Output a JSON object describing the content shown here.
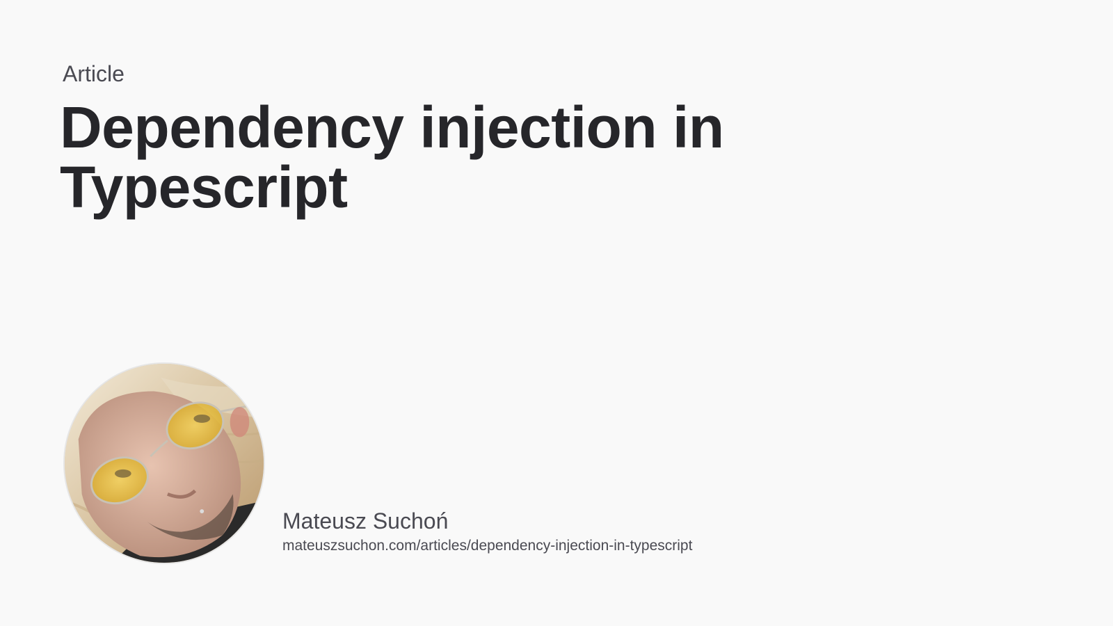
{
  "article": {
    "kind_label": "Article",
    "title": "Dependency injection in Typescript"
  },
  "author": {
    "name": "Mateusz Suchoń",
    "url": "mateuszsuchon.com/articles/dependency-injection-in-typescript",
    "avatar_icon": "author-photo"
  },
  "colors": {
    "background": "#f9f9f9",
    "title": "#26262a",
    "text": "#4a4a52"
  }
}
